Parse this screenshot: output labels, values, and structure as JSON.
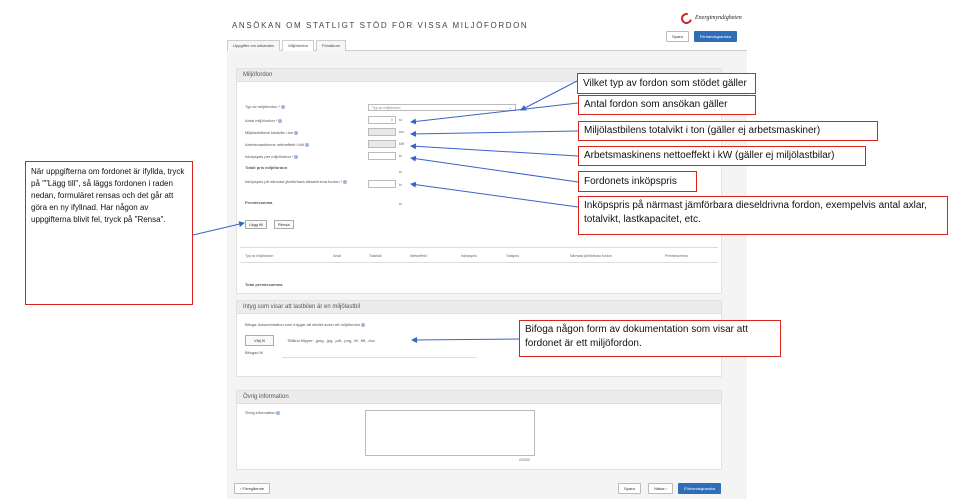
{
  "header": {
    "title": "ANSÖKAN OM STATLIGT STÖD FÖR VISSA MILJÖFORDON",
    "logo_text": "Energimyndigheten",
    "save_label": "Spara",
    "preview_label": "Förhandsgranska"
  },
  "tabs": [
    "Uppgifter om sökanden",
    "Miljöfordon",
    "Försäkran"
  ],
  "section_vehicles": {
    "title": "Miljöfordon",
    "fields": {
      "vehicle_type": {
        "label": "Typ av miljöfordon *",
        "placeholder": "Typ av miljöfordon"
      },
      "count": {
        "label": "Antal miljöfordon *",
        "value": "0",
        "unit": "st"
      },
      "total_weight": {
        "label": "Miljölastbilens totalvikt i ton",
        "unit": "ton"
      },
      "net_power": {
        "label": "Arbetsmaskinens nettoeffekt i kW",
        "unit": "kW"
      },
      "price": {
        "label": "Inköpspris per miljöfordon *",
        "unit": "kr"
      },
      "total_price": {
        "label": "Totalt pris miljöfordon",
        "unit": "kr"
      },
      "diesel_price": {
        "label": "Inköpspris på närmast jämförbara dieseldrivna fordon *",
        "unit": "kr"
      },
      "premium": {
        "label": "Premiesumma",
        "unit": "kr"
      }
    },
    "add_label": "Lägg till",
    "clear_label": "Rensa",
    "table_headers": [
      "Typ av miljöfordon",
      "Antal",
      "Totalvikt",
      "Nettoeffekt",
      "Inköpspris",
      "Totalpris",
      "Närmast jämförbara fordon",
      "Premiesumma"
    ],
    "total_premium_label": "Total premiesumma"
  },
  "section_certificate": {
    "title": "Intyg som visar att lastbilen är en miljölastbil",
    "attach_label": "Bifoga dokumentation som intygar att stödet avser ett miljöfordon",
    "file_button": "Välj fil",
    "file_types": "Tillåtna filtyper: .jpeg, .jpg, .pdf, .png, .tif, .tiff, .doc",
    "attached_label": "Bifogad fil"
  },
  "section_other": {
    "title": "Övrig information",
    "field_label": "Övrig information",
    "counter": "0/2000"
  },
  "footer": {
    "previous_label": "‹ Föregående",
    "save_label": "Spara",
    "next_label": "Nästa ›",
    "preview_label": "Förhandsgranska"
  },
  "callouts": {
    "vehicle_type": "Vilket typ av fordon som stödet gäller",
    "count": "Antal fordon som ansökan gäller",
    "total_weight": "Miljölastbilens totalvikt i ton (gäller ej arbetsmaskiner)",
    "net_power": "Arbetsmaskinens nettoeffekt i kW (gäller ej miljölastbilar)",
    "price": "Fordonets inköpspris",
    "diesel_price": "Inköpspris på närmast jämförbara dieseldrivna fordon, exempelvis antal axlar, totalvikt, lastkapacitet, etc.",
    "documentation": "Bifoga någon form av dokumentation som visar att fordonet är ett miljöfordon.",
    "left_note": "När uppgifterna om fordonet är ifyllda, tryck på \"\"Lägg till\", så läggs fordonen i raden nedan, formuläret rensas och det går att göra en ny ifyllnad. Har någon av uppgifterna blivit fel, tryck på \"Rensa\"."
  }
}
